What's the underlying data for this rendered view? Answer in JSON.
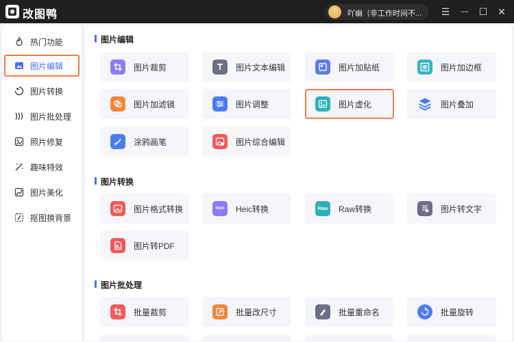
{
  "app": {
    "name": "改图鸭"
  },
  "user": {
    "text": "吖幽（非工作时间不..."
  },
  "window_controls": {
    "menu": "☰",
    "minimize": "—",
    "maximize": "☐",
    "close": "✕"
  },
  "sidebar": {
    "items": [
      {
        "label": "热门功能",
        "icon": "flame-icon",
        "active": false
      },
      {
        "label": "图片编辑",
        "icon": "image-edit-icon",
        "active": true
      },
      {
        "label": "图片转换",
        "icon": "convert-icon",
        "active": false
      },
      {
        "label": "图片批处理",
        "icon": "batch-icon",
        "active": false
      },
      {
        "label": "照片修复",
        "icon": "repair-icon",
        "active": false
      },
      {
        "label": "趣味特效",
        "icon": "magic-wand-icon",
        "active": false
      },
      {
        "label": "图片美化",
        "icon": "beautify-icon",
        "active": false
      },
      {
        "label": "抠图换背景",
        "icon": "cutout-icon",
        "active": false
      }
    ]
  },
  "sections": [
    {
      "title": "图片编辑",
      "items": [
        {
          "label": "图片裁剪",
          "icon": "crop-icon",
          "color": "#8b7cf6"
        },
        {
          "label": "图片文本编辑",
          "icon": "text-edit-icon",
          "color": "#6b6f86"
        },
        {
          "label": "图片加贴纸",
          "icon": "sticker-icon",
          "color": "#5b7cf0"
        },
        {
          "label": "图片加边框",
          "icon": "frame-icon",
          "color": "#33b6c6"
        },
        {
          "label": "图片加滤镜",
          "icon": "filter-icon",
          "color": "#f0883a"
        },
        {
          "label": "图片调整",
          "icon": "adjust-icon",
          "color": "#4a7cf2"
        },
        {
          "label": "图片虚化",
          "icon": "blur-icon",
          "color": "#2fb0b8",
          "selected": true
        },
        {
          "label": "图片叠加",
          "icon": "layers-icon",
          "color": "#4a7cf2"
        },
        {
          "label": "涂鸦画笔",
          "icon": "brush-icon",
          "color": "#4a7cf2"
        },
        {
          "label": "图片综合编辑",
          "icon": "composite-edit-icon",
          "color": "#f05a5a"
        }
      ]
    },
    {
      "title": "图片转换",
      "items": [
        {
          "label": "图片格式转换",
          "icon": "format-convert-icon",
          "color": "#f05a5a"
        },
        {
          "label": "Heic转换",
          "icon": "heic-icon",
          "color": "#8b7cf6",
          "badge": "Heic"
        },
        {
          "label": "Raw转换",
          "icon": "raw-icon",
          "color": "#2fb0b8",
          "badge": "Raw"
        },
        {
          "label": "图片转文字",
          "icon": "image-to-text-icon",
          "color": "#6b6f86"
        },
        {
          "label": "图片转PDF",
          "icon": "pdf-icon",
          "color": "#f05a5a"
        }
      ]
    },
    {
      "title": "图片批处理",
      "items": [
        {
          "label": "批量裁剪",
          "icon": "batch-crop-icon",
          "color": "#f05a5a"
        },
        {
          "label": "批量改尺寸",
          "icon": "batch-resize-icon",
          "color": "#f0883a"
        },
        {
          "label": "批量重命名",
          "icon": "batch-rename-icon",
          "color": "#6b6f86"
        },
        {
          "label": "批量旋转",
          "icon": "batch-rotate-icon",
          "color": "#4a7cf2"
        }
      ]
    }
  ]
}
